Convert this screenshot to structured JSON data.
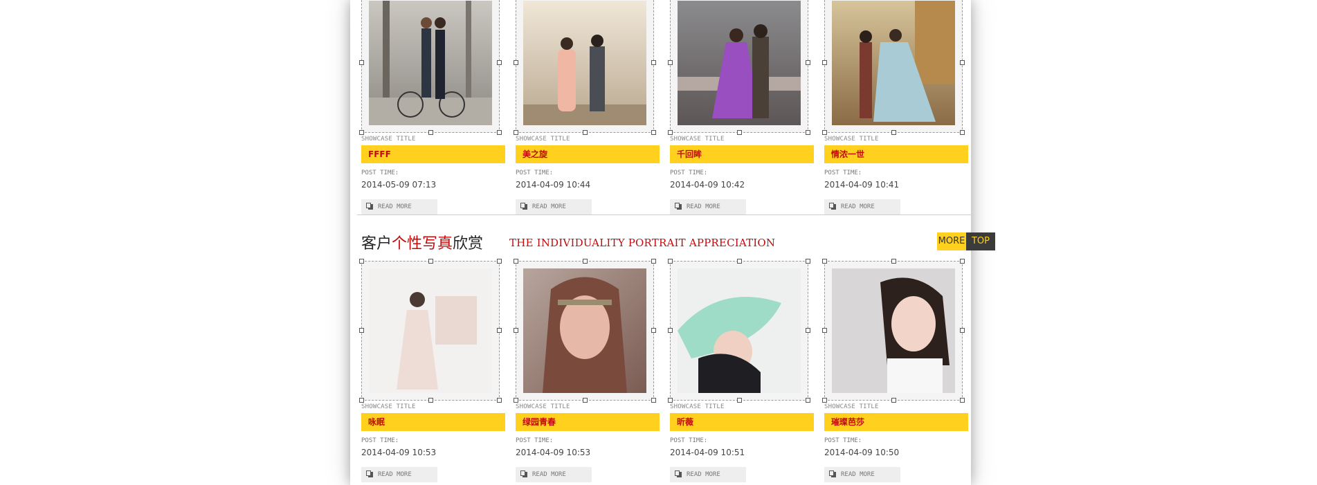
{
  "section_top": {
    "items": [
      {
        "label": "SHOWCASE TITLE",
        "title": "FFFF",
        "time_label": "POST TIME:",
        "time": "2014-05-09 07:13",
        "more": "READ MORE"
      },
      {
        "label": "SHOWCASE TITLE",
        "title": "美之旋",
        "time_label": "POST TIME:",
        "time": "2014-04-09 10:44",
        "more": "READ MORE"
      },
      {
        "label": "SHOWCASE TITLE",
        "title": "千回眸",
        "time_label": "POST TIME:",
        "time": "2014-04-09 10:42",
        "more": "READ MORE"
      },
      {
        "label": "SHOWCASE TITLE",
        "title": "情浓一世",
        "time_label": "POST TIME:",
        "time": "2014-04-09 10:41",
        "more": "READ MORE"
      }
    ]
  },
  "section_portrait": {
    "title_prefix": "客户",
    "title_highlight": "个性写真",
    "title_suffix": "欣赏",
    "title_en": "THE INDIVIDUALITY PORTRAIT APPRECIATION",
    "more_label": "MORE",
    "top_label": "TOP",
    "items": [
      {
        "label": "SHOWCASE TITLE",
        "title": "咏眠",
        "time_label": "POST TIME:",
        "time": "2014-04-09 10:53",
        "more": "READ MORE"
      },
      {
        "label": "SHOWCASE TITLE",
        "title": "绿园青春",
        "time_label": "POST TIME:",
        "time": "2014-04-09 10:53",
        "more": "READ MORE"
      },
      {
        "label": "SHOWCASE TITLE",
        "title": "昕薇",
        "time_label": "POST TIME:",
        "time": "2014-04-09 10:51",
        "more": "READ MORE"
      },
      {
        "label": "SHOWCASE TITLE",
        "title": "璀璨芭莎",
        "time_label": "POST TIME:",
        "time": "2014-04-09 10:50",
        "more": "READ MORE"
      }
    ]
  },
  "colors": {
    "accent_yellow": "#ffd01e",
    "accent_red": "#c30a0a",
    "dark": "#3b3b3b"
  },
  "icons": {
    "read_more": "document-icon"
  }
}
